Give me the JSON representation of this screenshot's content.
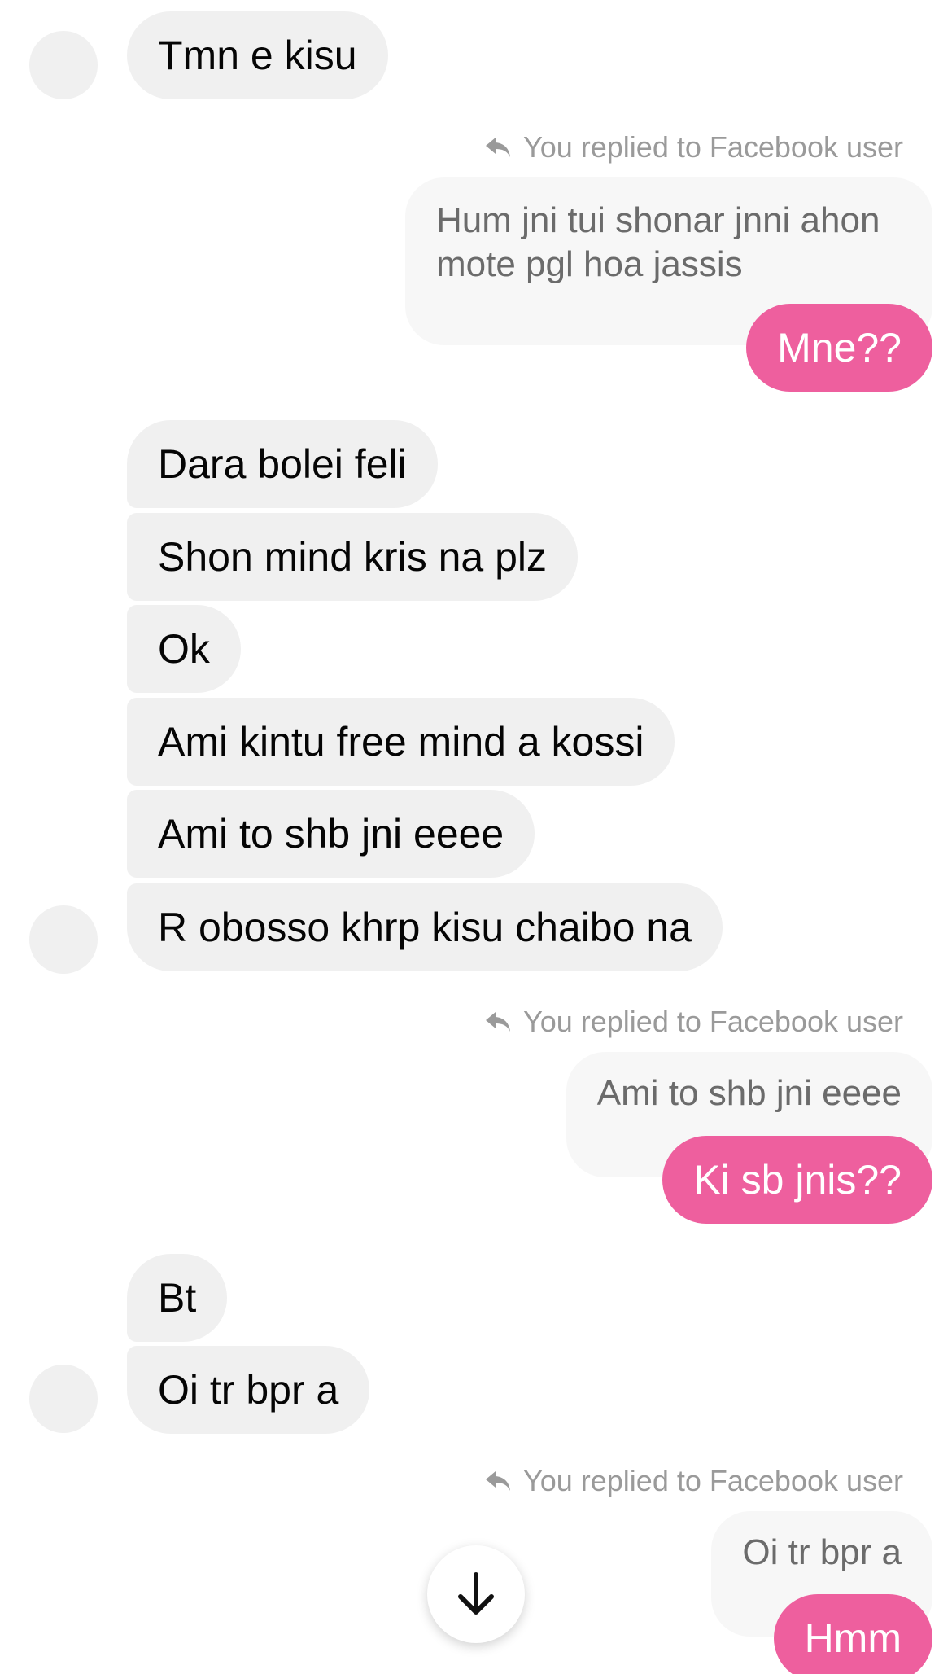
{
  "messages": {
    "m1": "Tmn e kisu",
    "reply1": {
      "label": "You replied to Facebook user",
      "quote": "Hum jni tui shonar jnni ahon mote pgl hoa jassis",
      "message": "Mne??"
    },
    "group2": [
      "Dara bolei feli",
      "Shon mind kris na plz",
      "Ok",
      "Ami kintu free mind a kossi",
      "Ami to shb jni eeee",
      "R obosso khrp kisu chaibo na"
    ],
    "reply2": {
      "label": "You replied to Facebook user",
      "quote": "Ami to shb jni eeee",
      "message": "Ki sb jnis??"
    },
    "group3": [
      "Bt",
      "Oi tr bpr a"
    ],
    "reply3": {
      "label": "You replied to Facebook user",
      "quote": "Oi tr bpr a",
      "message": "Hmm"
    }
  },
  "icons": {
    "reply": "reply-arrow-icon",
    "scroll": "arrow-down-icon"
  },
  "colors": {
    "outgoing_bubble": "#ee5f9e",
    "incoming_bubble": "#f0f0f0",
    "quote_bubble": "#f7f7f7",
    "meta_text": "#9a9a9a"
  }
}
